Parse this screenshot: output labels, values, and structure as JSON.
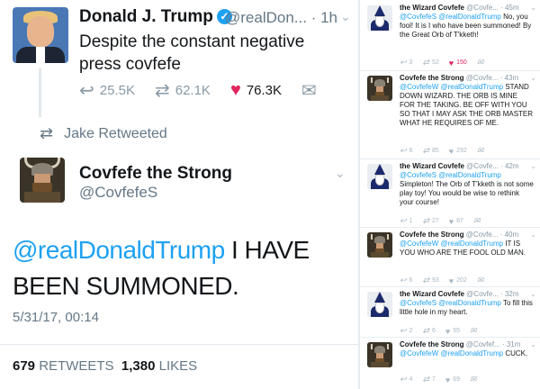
{
  "left": {
    "tweet1": {
      "name": "Donald J. Trump",
      "handle": "@realDon...",
      "time": "· 1h",
      "text": "Despite the constant negative press covfefe",
      "replies": "25.5K",
      "retweets": "62.1K",
      "likes": "76.3K"
    },
    "retweet_notice": "Jake Retweeted",
    "tweet2": {
      "name": "Covfefe the Strong",
      "handle": "@CovfefeS",
      "mention": "@realDonaldTrump",
      "text": " I HAVE BEEN SUMMONED.",
      "date": "5/31/17, 00:14",
      "retweet_count": "679",
      "retweet_label": "RETWEETS",
      "like_count": "1,380",
      "like_label": "LIKES"
    }
  },
  "right": {
    "tweets": [
      {
        "name": "the Wizard Covfefe",
        "meta": "@Covfe... · 45m",
        "mentions": "@CovfefeS @realDonaldTrump",
        "text": " No, you fool! It is I who have been summoned! By the Great Orb of T'kketh!",
        "replies": "3",
        "retweets": "52",
        "likes": "150"
      },
      {
        "name": "Covfefe the Strong",
        "meta": "@Covfe... · 43m",
        "mentions": "@CovfefeW @realDonaldTrump",
        "text": " STAND DOWN WIZARD. THE ORB IS MINE FOR THE TAKING. BE OFF WITH YOU SO THAT I MAY ASK THE ORB MASTER WHAT HE REQUIRES OF ME.",
        "replies": "6",
        "retweets": "85",
        "likes": "292"
      },
      {
        "name": "the Wizard Covfefe",
        "meta": "@Covfe... · 42m",
        "mentions": "@CovfefeS @realDonaldTrump",
        "text": " Simpleton! The Orb of T'kketh is not some play toy! You would be wise to rethink your course!",
        "replies": "1",
        "retweets": "27",
        "likes": "87"
      },
      {
        "name": "Covfefe the Strong",
        "meta": "@Covfe... · 40m",
        "mentions": "@CovfefeW @realDonaldTrump",
        "text": " IT IS YOU WHO ARE THE FOOL OLD MAN.",
        "replies": "6",
        "retweets": "93",
        "likes": "202"
      },
      {
        "name": "the Wizard Covfefe",
        "meta": "@Covfe... · 32m",
        "mentions": "@CovfefeS @realDonaldTrump",
        "text": " To fill this little hole in my heart.",
        "replies": "2",
        "retweets": "6",
        "likes": "55"
      },
      {
        "name": "Covfefe the Strong",
        "meta": "@Covfef... · 31m",
        "mentions": "@CovfefeW @realDonaldTrump",
        "text": " CUCK.",
        "replies": "4",
        "retweets": "7",
        "likes": "69"
      }
    ]
  },
  "icons": {
    "reply": "reply-icon",
    "retweet": "retweet-icon",
    "like": "heart-icon",
    "dm": "envelope-icon"
  },
  "colors": {
    "link": "#1da1f2",
    "like": "#e0245e",
    "muted": "#657786"
  }
}
